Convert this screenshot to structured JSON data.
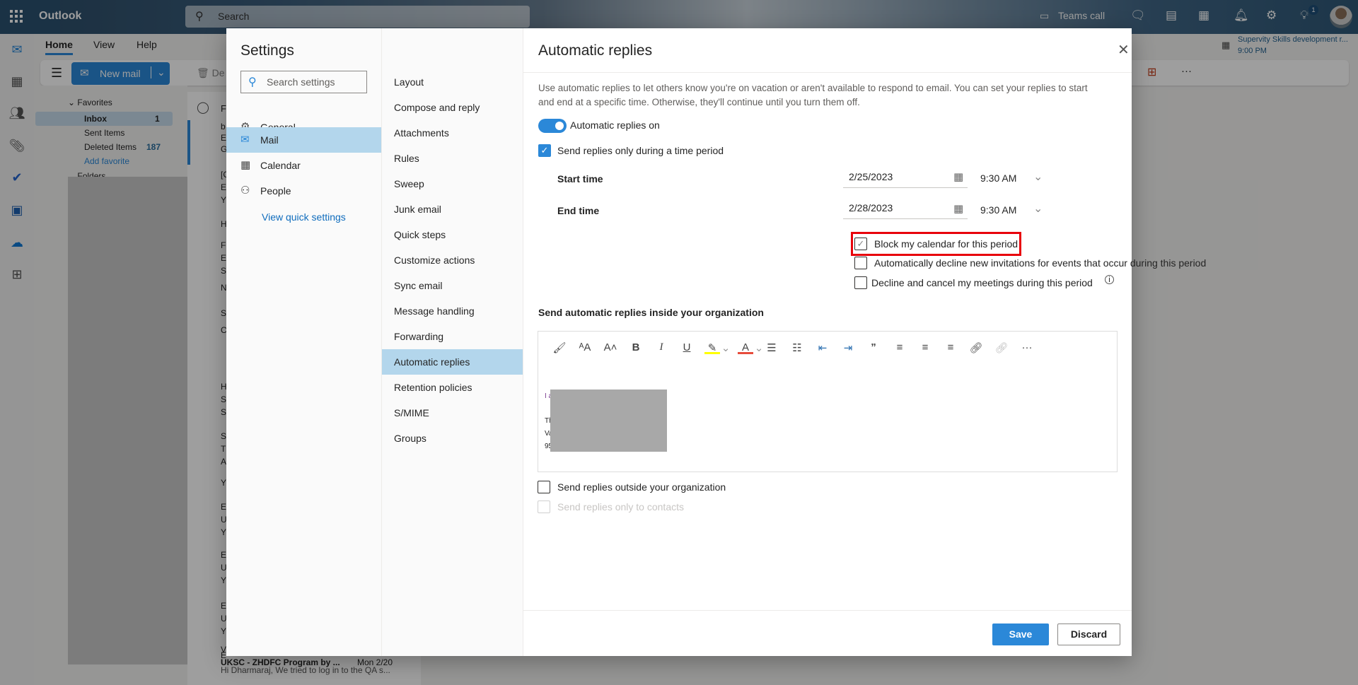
{
  "app": {
    "title": "Outlook",
    "search_placeholder": "Search",
    "teams_call": "Teams call",
    "notification_count": "1"
  },
  "ribbon": {
    "tabs": [
      "Home",
      "View",
      "Help"
    ],
    "new_mail": "New mail",
    "delete_partial": "De"
  },
  "event": {
    "title": "Supervity Skills development r...",
    "time": "9:00 PM"
  },
  "folders": {
    "favorites": "Favorites",
    "items": [
      {
        "label": "Inbox",
        "count": "1"
      },
      {
        "label": "Sent Items",
        "count": ""
      },
      {
        "label": "Deleted Items",
        "count": "187"
      }
    ],
    "add_favorite": "Add favorite",
    "folders_label": "Folders"
  },
  "message_list": {
    "header_partial": "F",
    "fragments": [
      "b",
      "E",
      "G",
      "[C",
      "E",
      "Y",
      "H",
      "F",
      "E",
      "S",
      "N",
      "S",
      "C",
      "H",
      "S",
      "S",
      "S",
      "T",
      "A",
      "Y",
      "E",
      "U",
      "Y",
      "E",
      "U",
      "Y",
      "E",
      "U",
      "Y",
      "E",
      "V"
    ],
    "last_subject": "UKSC - ZHDFC Program by ...",
    "last_date": "Mon 2/20",
    "last_preview": "Hi Dharmaraj, We tried to log in to the QA s..."
  },
  "settings": {
    "title": "Settings",
    "search_placeholder": "Search settings",
    "categories": [
      {
        "label": "General",
        "icon": "gear-icon"
      },
      {
        "label": "Mail",
        "icon": "mail-icon",
        "selected": true
      },
      {
        "label": "Calendar",
        "icon": "calendar-icon"
      },
      {
        "label": "People",
        "icon": "people-icon"
      }
    ],
    "view_quick_settings": "View quick settings",
    "mail_sections": [
      "Layout",
      "Compose and reply",
      "Attachments",
      "Rules",
      "Sweep",
      "Junk email",
      "Quick steps",
      "Customize actions",
      "Sync email",
      "Message handling",
      "Forwarding",
      "Automatic replies",
      "Retention policies",
      "S/MIME",
      "Groups"
    ],
    "selected_section": "Automatic replies"
  },
  "auto_replies": {
    "title": "Automatic replies",
    "description": "Use automatic replies to let others know you're on vacation or aren't available to respond to email. You can set your replies to start and end at a specific time. Otherwise, they'll continue until you turn them off.",
    "toggle_label": "Automatic replies on",
    "toggle_on": true,
    "time_period_label": "Send replies only during a time period",
    "time_period_checked": true,
    "start_label": "Start time",
    "start_date": "2/25/2023",
    "start_time": "9:30 AM",
    "end_label": "End time",
    "end_date": "2/28/2023",
    "end_time": "9:30 AM",
    "block_calendar": "Block my calendar for this period",
    "block_calendar_checked": true,
    "decline_new": "Automatically decline new invitations for events that occur during this period",
    "decline_cancel": "Decline and cancel my meetings during this period",
    "inside_heading": "Send automatic replies inside your organization",
    "body_fragments": [
      "I a",
      "Th",
      "Va",
      "95"
    ],
    "outside_label": "Send replies outside your organization",
    "contacts_label": "Send replies only to contacts",
    "save": "Save",
    "discard": "Discard"
  },
  "colors": {
    "accent": "#2b88d8",
    "selected": "#b3d6ec",
    "highlight_box": "#e8000b"
  }
}
